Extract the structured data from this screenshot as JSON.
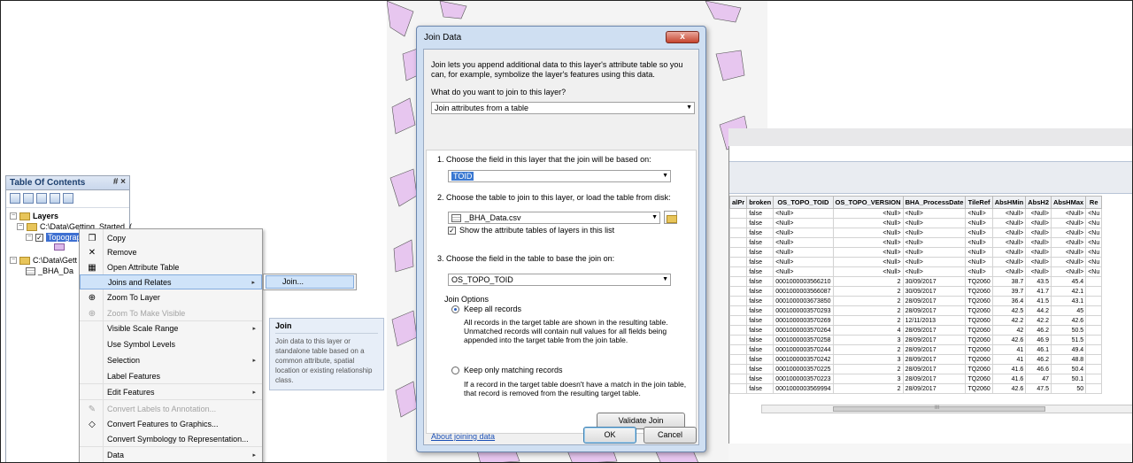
{
  "toc": {
    "title": "Table Of Contents",
    "title_controls": "# ×",
    "layers_label": "Layers",
    "data_frame_1": "C:\\Data\\Getting_Started_(",
    "selected_layer": "Topograph",
    "data_frame_2": "C:\\Data\\Gett",
    "table_item": "_BHA_Da"
  },
  "context_menu": {
    "items": [
      {
        "label": "Copy",
        "icon": "copy-icon",
        "glyph": "❐"
      },
      {
        "label": "Remove",
        "icon": "remove-icon",
        "glyph": "✕"
      },
      {
        "label": "Open Attribute Table",
        "icon": "table-icon",
        "glyph": "▦"
      },
      {
        "label": "Joins and Relates",
        "icon": "",
        "glyph": ""
      },
      {
        "label": "Zoom To Layer",
        "icon": "zoom-layer-icon",
        "glyph": "⊕"
      },
      {
        "label": "Zoom To Make Visible",
        "icon": "zoom-visible-icon",
        "glyph": "⊕"
      },
      {
        "label": "Visible Scale Range",
        "icon": "",
        "glyph": ""
      },
      {
        "label": "Use Symbol Levels",
        "icon": "",
        "glyph": ""
      },
      {
        "label": "Selection",
        "icon": "",
        "glyph": ""
      },
      {
        "label": "Label Features",
        "icon": "",
        "glyph": ""
      },
      {
        "label": "Edit Features",
        "icon": "",
        "glyph": ""
      },
      {
        "label": "Convert Labels to Annotation...",
        "icon": "convert-labels-icon",
        "glyph": "✎"
      },
      {
        "label": "Convert Features to Graphics...",
        "icon": "convert-graphics-icon",
        "glyph": "◇"
      },
      {
        "label": "Convert Symbology to Representation...",
        "icon": "",
        "glyph": ""
      },
      {
        "label": "Data",
        "icon": "",
        "glyph": ""
      },
      {
        "label": "Save As Layer File...",
        "icon": "save-layer-icon",
        "glyph": "◆"
      }
    ],
    "submenu_arrow": "▸"
  },
  "submenu": {
    "join_label": "Join...",
    "tooltip_title": "Join",
    "tooltip_body": "Join data to this layer or standalone table based on a common attribute, spatial location or existing relationship class."
  },
  "dialog": {
    "title": "Join Data",
    "close_label": "x",
    "intro": "Join lets you append additional data to this layer's attribute table so you can, for example, symbolize the layer's features using this data.",
    "question": "What do you want to join to this layer?",
    "join_type": "Join attributes from a table",
    "step1_label": "1.  Choose the field in this layer that the join will be based on:",
    "step1_value": "TOID",
    "step2_label": "2.  Choose the table to join to this layer, or load the table from disk:",
    "step2_value": "_BHA_Data.csv",
    "show_tables_label": "Show the attribute tables of layers in this list",
    "step3_label": "3.  Choose the field in the table to base the join on:",
    "step3_value": "OS_TOPO_TOID",
    "join_options_label": "Join Options",
    "keep_all_label": "Keep all records",
    "keep_all_desc": "All records in the target table are shown in the resulting table. Unmatched records will contain null values for all fields being appended into the target table from the join table.",
    "keep_matching_label": "Keep only matching records",
    "keep_matching_desc": "If a record in the target table doesn't have a match in the join table, that record is removed from the resulting target table.",
    "validate_label": "Validate Join",
    "about_link": "About joining data",
    "ok_label": "OK",
    "cancel_label": "Cancel"
  },
  "attr_table": {
    "columns": [
      "alPr",
      "broken",
      "OS_TOPO_TOID",
      "OS_TOPO_VERSION",
      "BHA_ProcessDate",
      "TileRef",
      "AbsHMin",
      "AbsH2",
      "AbsHMax",
      "Re"
    ],
    "rows": [
      [
        "",
        "false",
        "<Null>",
        "<Null>",
        "<Null>",
        "<Null>",
        "<Null>",
        "<Null>",
        "<Null>",
        "<Nu"
      ],
      [
        "",
        "false",
        "<Null>",
        "<Null>",
        "<Null>",
        "<Null>",
        "<Null>",
        "<Null>",
        "<Null>",
        "<Nu"
      ],
      [
        "",
        "false",
        "<Null>",
        "<Null>",
        "<Null>",
        "<Null>",
        "<Null>",
        "<Null>",
        "<Null>",
        "<Nu"
      ],
      [
        "",
        "false",
        "<Null>",
        "<Null>",
        "<Null>",
        "<Null>",
        "<Null>",
        "<Null>",
        "<Null>",
        "<Nu"
      ],
      [
        "",
        "false",
        "<Null>",
        "<Null>",
        "<Null>",
        "<Null>",
        "<Null>",
        "<Null>",
        "<Null>",
        "<Nu"
      ],
      [
        "",
        "false",
        "<Null>",
        "<Null>",
        "<Null>",
        "<Null>",
        "<Null>",
        "<Null>",
        "<Null>",
        "<Nu"
      ],
      [
        "",
        "false",
        "<Null>",
        "<Null>",
        "<Null>",
        "<Null>",
        "<Null>",
        "<Null>",
        "<Null>",
        "<Nu"
      ],
      [
        "",
        "false",
        "0001000003566210",
        "2",
        "30/09/2017",
        "TQ2060",
        "38.7",
        "43.5",
        "45.4",
        ""
      ],
      [
        "",
        "false",
        "0001000003566087",
        "2",
        "30/09/2017",
        "TQ2060",
        "39.7",
        "41.7",
        "42.1",
        ""
      ],
      [
        "",
        "false",
        "0001000003673850",
        "2",
        "28/09/2017",
        "TQ2060",
        "36.4",
        "41.5",
        "43.1",
        ""
      ],
      [
        "",
        "false",
        "0001000003570293",
        "2",
        "28/09/2017",
        "TQ2060",
        "42.5",
        "44.2",
        "45",
        ""
      ],
      [
        "",
        "false",
        "0001000003570269",
        "2",
        "12/11/2013",
        "TQ2060",
        "42.2",
        "42.2",
        "42.6",
        ""
      ],
      [
        "",
        "false",
        "0001000003570264",
        "4",
        "28/09/2017",
        "TQ2060",
        "42",
        "46.2",
        "50.5",
        ""
      ],
      [
        "",
        "false",
        "0001000003570258",
        "3",
        "28/09/2017",
        "TQ2060",
        "42.6",
        "46.9",
        "51.5",
        ""
      ],
      [
        "",
        "false",
        "0001000003570244",
        "2",
        "28/09/2017",
        "TQ2060",
        "41",
        "46.1",
        "49.4",
        ""
      ],
      [
        "",
        "false",
        "0001000003570242",
        "3",
        "28/09/2017",
        "TQ2060",
        "41",
        "46.2",
        "48.8",
        ""
      ],
      [
        "",
        "false",
        "0001000003570225",
        "2",
        "28/09/2017",
        "TQ2060",
        "41.6",
        "46.6",
        "50.4",
        ""
      ],
      [
        "",
        "false",
        "0001000003570223",
        "3",
        "28/09/2017",
        "TQ2060",
        "41.6",
        "47",
        "50.1",
        ""
      ],
      [
        "",
        "false",
        "0001000003569994",
        "2",
        "28/09/2017",
        "TQ2060",
        "42.6",
        "47.5",
        "50",
        ""
      ]
    ],
    "scroll_marker": "III"
  }
}
